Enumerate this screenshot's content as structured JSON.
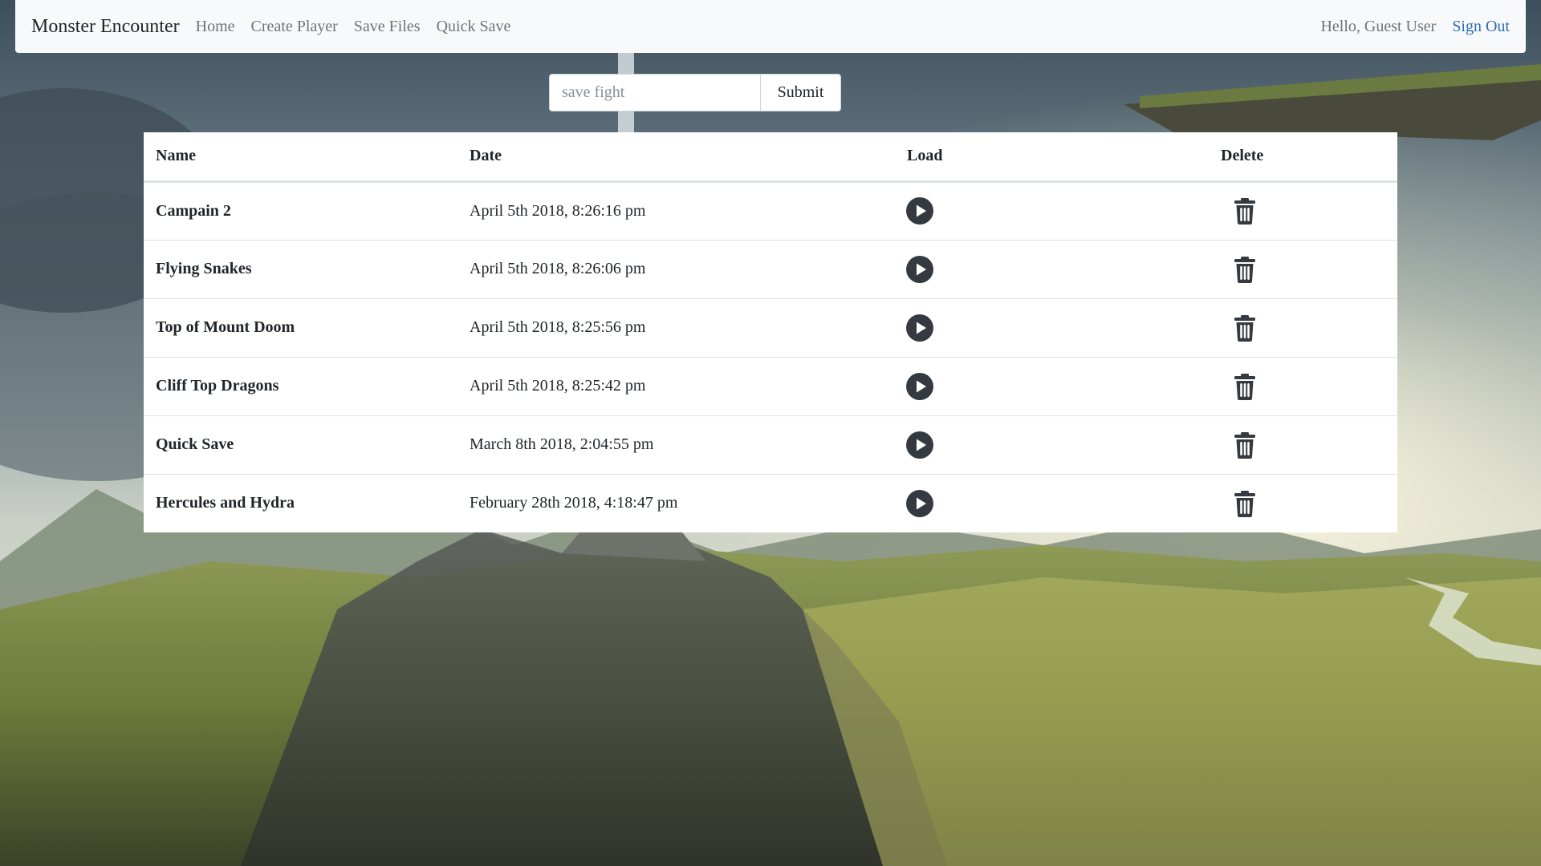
{
  "nav": {
    "brand": "Monster Encounter",
    "links": [
      "Home",
      "Create Player",
      "Save Files",
      "Quick Save"
    ],
    "greeting": "Hello, Guest User",
    "sign_out": "Sign Out"
  },
  "save_form": {
    "placeholder": "save fight",
    "value": "",
    "submit_label": "Submit"
  },
  "table": {
    "headers": [
      "Name",
      "Date",
      "Load",
      "Delete"
    ],
    "rows": [
      {
        "name": "Campain 2",
        "date": "April 5th 2018, 8:26:16 pm"
      },
      {
        "name": "Flying Snakes",
        "date": "April 5th 2018, 8:26:06 pm"
      },
      {
        "name": "Top of Mount Doom",
        "date": "April 5th 2018, 8:25:56 pm"
      },
      {
        "name": "Cliff Top Dragons",
        "date": "April 5th 2018, 8:25:42 pm"
      },
      {
        "name": "Quick Save",
        "date": "March 8th 2018, 2:04:55 pm"
      },
      {
        "name": "Hercules and Hydra",
        "date": "February 28th 2018, 4:18:47 pm"
      }
    ],
    "load_icon": "play-circle-icon",
    "delete_icon": "trash-icon"
  },
  "colors": {
    "navbar_bg": "#f8f9fa",
    "link_accent": "#2c6bb0",
    "icon_fill": "#343a40"
  }
}
